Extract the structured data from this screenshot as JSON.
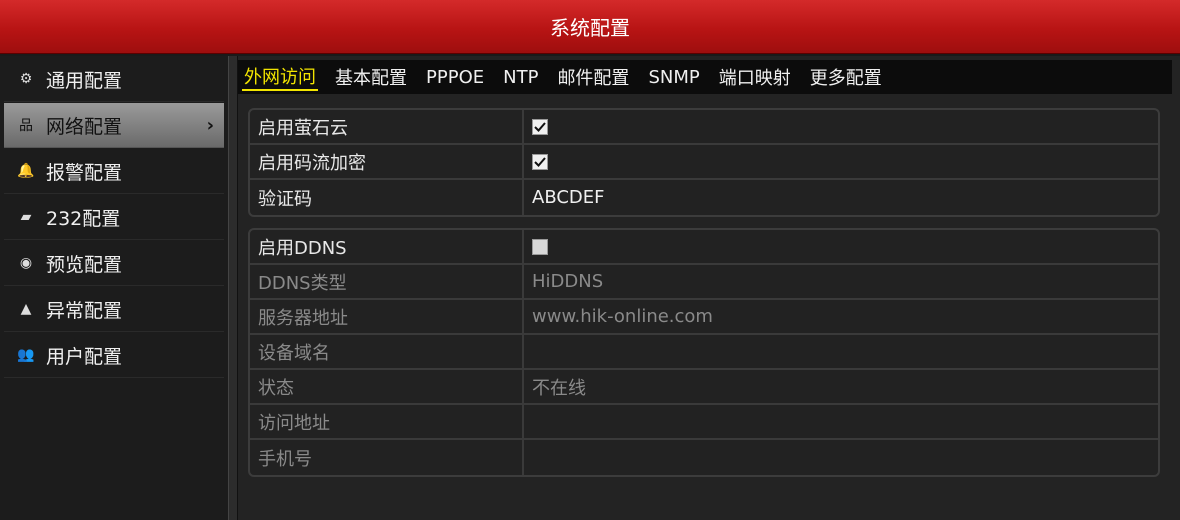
{
  "window": {
    "title": "系统配置"
  },
  "sidebar": {
    "items": [
      {
        "label": "通用配置",
        "icon": "gear-icon",
        "glyph": "⚙",
        "active": false
      },
      {
        "label": "网络配置",
        "icon": "network-icon",
        "glyph": "品",
        "active": true,
        "arrow": "›"
      },
      {
        "label": "报警配置",
        "icon": "alarm-bell-icon",
        "glyph": "🔔",
        "active": false
      },
      {
        "label": "232配置",
        "icon": "serial-port-icon",
        "glyph": "▰",
        "active": false
      },
      {
        "label": "预览配置",
        "icon": "eye-icon",
        "glyph": "◉",
        "active": false
      },
      {
        "label": "异常配置",
        "icon": "warning-icon",
        "glyph": "▲",
        "active": false
      },
      {
        "label": "用户配置",
        "icon": "users-icon",
        "glyph": "👥",
        "active": false
      }
    ]
  },
  "tabs": [
    {
      "label": "外网访问",
      "active": true
    },
    {
      "label": "基本配置",
      "active": false
    },
    {
      "label": "PPPOE",
      "active": false
    },
    {
      "label": "NTP",
      "active": false
    },
    {
      "label": "邮件配置",
      "active": false
    },
    {
      "label": "SNMP",
      "active": false
    },
    {
      "label": "端口映射",
      "active": false
    },
    {
      "label": "更多配置",
      "active": false
    }
  ],
  "ezviz": {
    "enable_label": "启用萤石云",
    "enable_checked": true,
    "encrypt_label": "启用码流加密",
    "encrypt_checked": true,
    "code_label": "验证码",
    "code_value": "ABCDEF"
  },
  "ddns": {
    "enable_label": "启用DDNS",
    "enable_checked": false,
    "type_label": "DDNS类型",
    "type_value": "HiDDNS",
    "server_label": "服务器地址",
    "server_value": "www.hik-online.com",
    "domain_label": "设备域名",
    "domain_value": "",
    "status_label": "状态",
    "status_value": "不在线",
    "access_label": "访问地址",
    "access_value": "",
    "phone_label": "手机号",
    "phone_value": ""
  },
  "colors": {
    "title_red": "#c81e1e",
    "tab_active": "#f2e400"
  }
}
